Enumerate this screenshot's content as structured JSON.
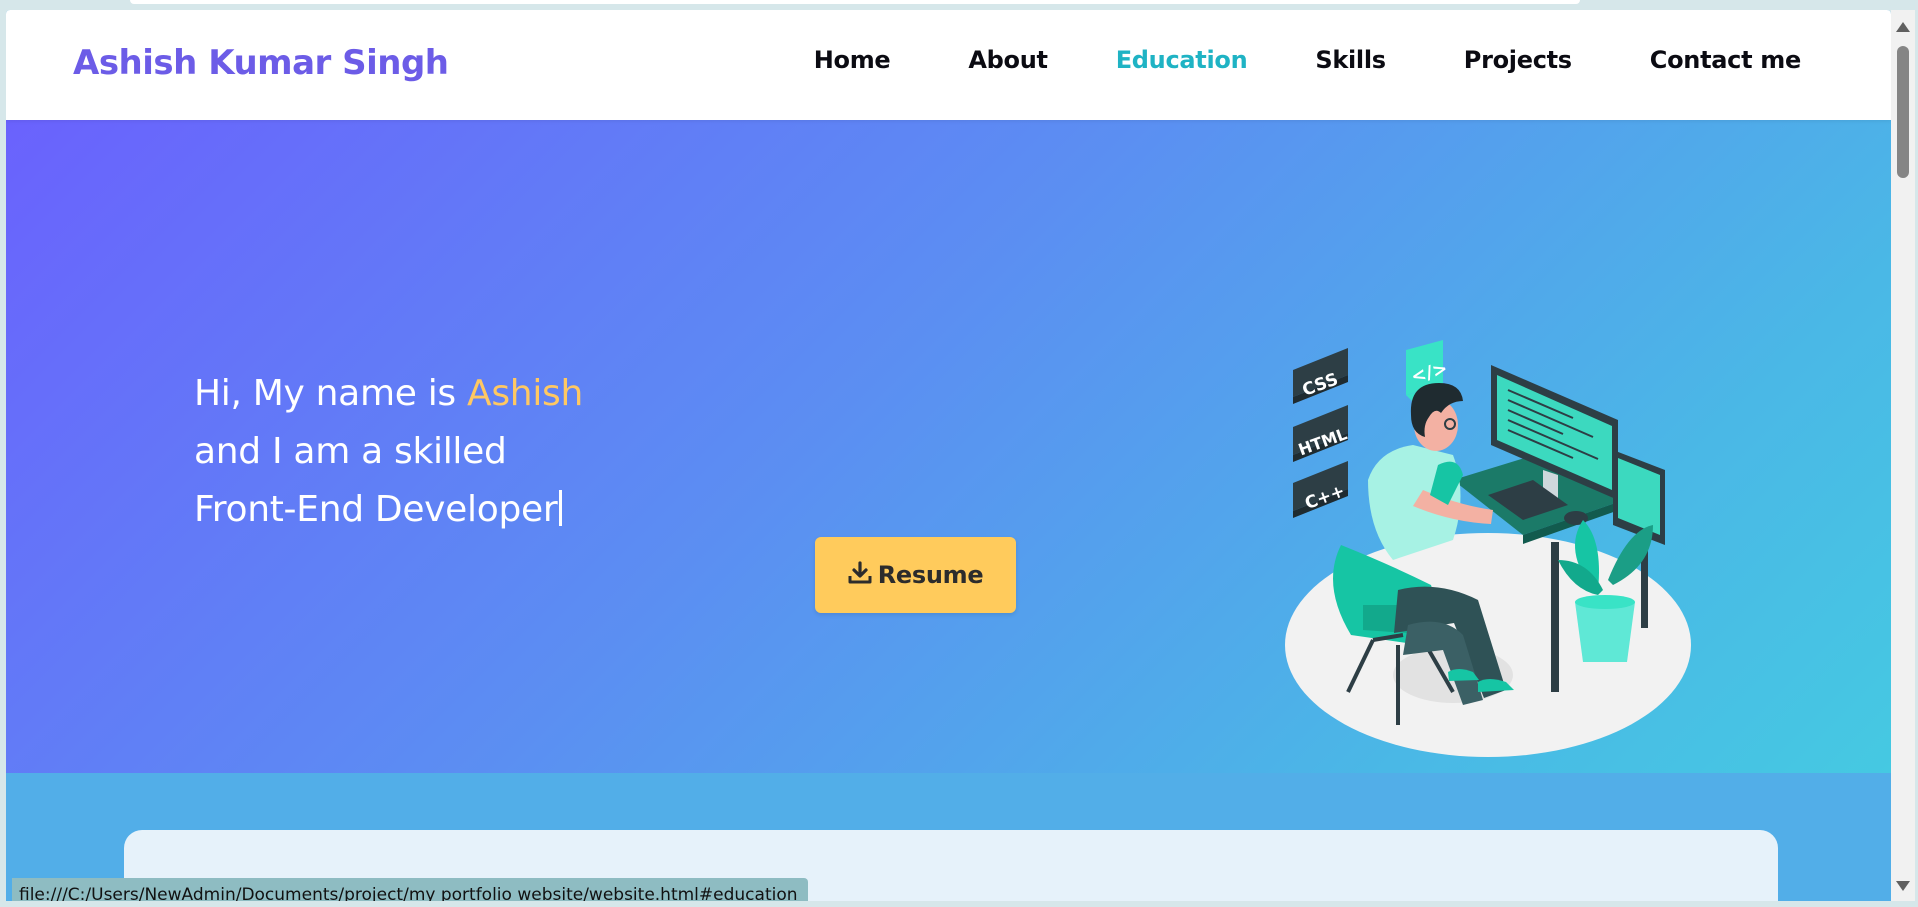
{
  "navbar": {
    "brand": "Ashish Kumar Singh",
    "links": [
      {
        "label": "Home",
        "active": false
      },
      {
        "label": "About",
        "active": false
      },
      {
        "label": "Education",
        "active": true
      },
      {
        "label": "Skills",
        "active": false
      },
      {
        "label": "Projects",
        "active": false
      },
      {
        "label": "Contact me",
        "active": false
      }
    ]
  },
  "hero": {
    "line1_prefix": "Hi, My name is ",
    "line1_name": "Ashish",
    "line2": "and I am a skilled",
    "line3": "Front-End Developer",
    "resume_label": "Resume",
    "resume_icon": "download-icon",
    "illustration_tags": [
      "CSS",
      "HTML",
      "C++",
      "</>"
    ]
  },
  "status_bar": {
    "url": "file:///C:/Users/NewAdmin/Documents/project/my portfolio website/website.html#education"
  },
  "colors": {
    "brand": "#6c5ce7",
    "active_link": "#1fb3c4",
    "name_highlight": "#ffc862",
    "resume_button": "#ffcb5c",
    "hero_gradient_start": "#6a62fd",
    "hero_gradient_end": "#45c9e2"
  }
}
